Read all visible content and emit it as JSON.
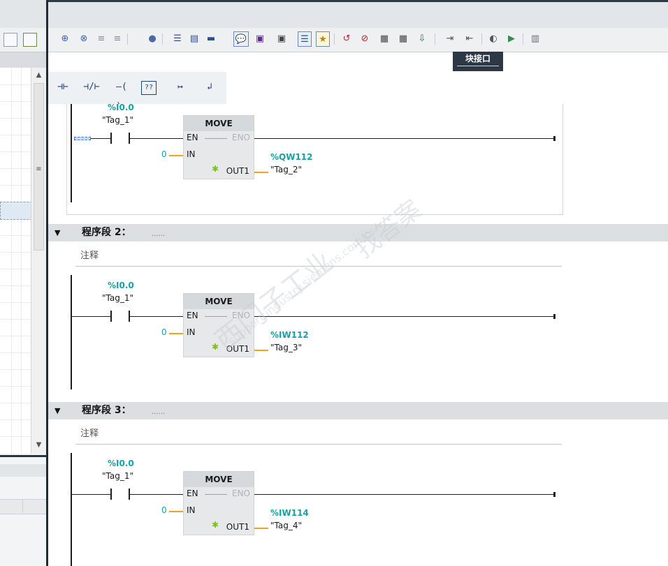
{
  "left_panel": {
    "scroll_mark": "≡"
  },
  "toolbar": {
    "icons": [
      "insert-network-icon",
      "delete-network-icon",
      "insert-row-icon",
      "insert-row-below-icon",
      "stop-icon",
      "list-icon",
      "collapse-all-icon",
      "expand-all-icon",
      "comment-icon",
      "absolute-address-icon",
      "symbolic-address-icon",
      "network-view-icon",
      "favorites-icon",
      "go-online-icon",
      "go-offline-icon",
      "monitor-icon",
      "compare-icon",
      "download-icon",
      "indent-icon",
      "outdent-icon",
      "watch-icon",
      "simulation-icon",
      "split-view-icon"
    ]
  },
  "block_interface": {
    "label": "块接口"
  },
  "instructions": {
    "items": [
      {
        "name": "no-contact",
        "glyph": "⊣⊢"
      },
      {
        "name": "nc-contact",
        "glyph": "⊣/⊢"
      },
      {
        "name": "coil",
        "glyph": "–( )–"
      },
      {
        "name": "empty-box",
        "glyph": "??"
      },
      {
        "name": "open-branch",
        "glyph": "↦"
      },
      {
        "name": "close-branch",
        "glyph": "↲"
      }
    ]
  },
  "networks": [
    {
      "title": "",
      "comment": "",
      "contact_address": "%I0.0",
      "contact_tag": "\"Tag_1\"",
      "box_title": "MOVE",
      "en": "EN",
      "eno": "ENO",
      "in_label": "IN",
      "in_value": "0",
      "out_label": "OUT1",
      "out_address": "%QW112",
      "out_tag": "\"Tag_2\""
    },
    {
      "title": "程序段 2：",
      "dots": "......",
      "comment": "注释",
      "contact_address": "%I0.0",
      "contact_tag": "\"Tag_1\"",
      "box_title": "MOVE",
      "en": "EN",
      "eno": "ENO",
      "in_label": "IN",
      "in_value": "0",
      "out_label": "OUT1",
      "out_address": "%IW112",
      "out_tag": "\"Tag_3\""
    },
    {
      "title": "程序段 3：",
      "dots": "......",
      "comment": "注释",
      "contact_address": "%I0.0",
      "contact_tag": "\"Tag_1\"",
      "box_title": "MOVE",
      "en": "EN",
      "eno": "ENO",
      "in_label": "IN",
      "in_value": "0",
      "out_label": "OUT1",
      "out_address": "%IW114",
      "out_tag": "\"Tag_4\""
    }
  ],
  "watermark": {
    "line1": "西门子工业",
    "line2": "找答案",
    "line3": "support.industry.siemens.com/cs"
  },
  "colors": {
    "address": "#1aa0a4",
    "wire": "#f2a11b",
    "header_bg": "#dcdfe2",
    "frame_dark": "#1e2a36"
  }
}
